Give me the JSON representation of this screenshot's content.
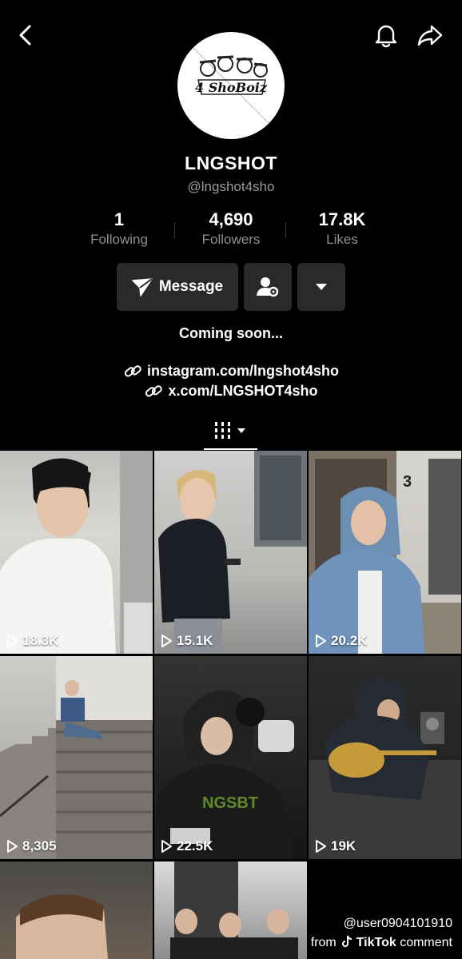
{
  "profile": {
    "name": "LNGSHOT",
    "handle": "@lngshot4sho",
    "avatar_text": "4 ShoBoiz",
    "bio": "Coming soon...",
    "links": [
      "instagram.com/lngshot4sho",
      "x.com/LNGSHOT4sho"
    ]
  },
  "stats": [
    {
      "value": "1",
      "label": "Following"
    },
    {
      "value": "4,690",
      "label": "Followers"
    },
    {
      "value": "17.8K",
      "label": "Likes"
    }
  ],
  "actions": {
    "message_label": "Message"
  },
  "icons": {
    "back": "back-arrow-icon",
    "bell": "bell-icon",
    "share": "share-icon",
    "message": "send-icon",
    "follow": "person-settings-icon",
    "more": "dropdown-icon",
    "link": "link-icon",
    "grid_tab": "grid-icon",
    "play": "play-icon"
  },
  "videos": [
    {
      "views": "18.3K"
    },
    {
      "views": "15.1K"
    },
    {
      "views": "20.2K"
    },
    {
      "views": "8,305"
    },
    {
      "views": "22.5K"
    },
    {
      "views": "19K"
    },
    {
      "views": ""
    },
    {
      "views": ""
    },
    {
      "views": ""
    }
  ],
  "watermark": {
    "user": "@user0904101910",
    "from": "from",
    "brand": "TikTok",
    "suffix": "comment"
  }
}
